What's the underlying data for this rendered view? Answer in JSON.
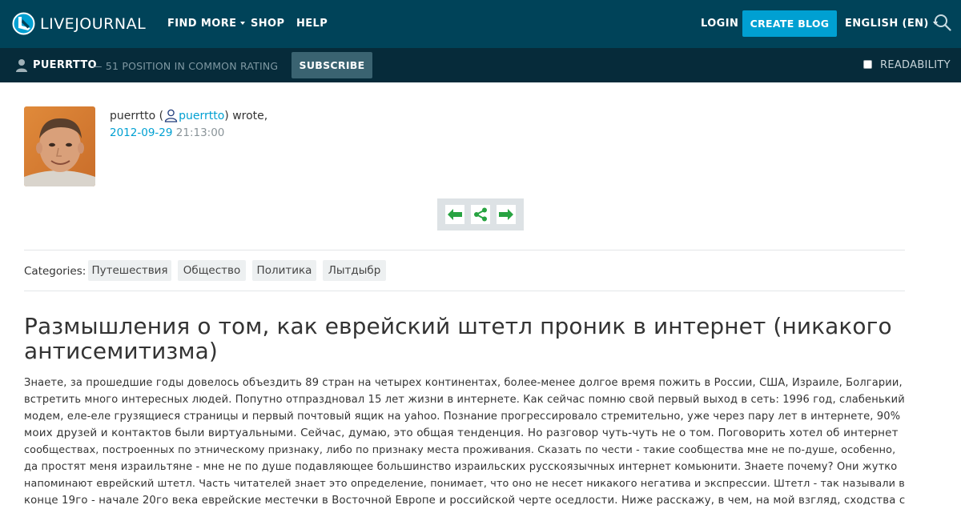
{
  "header": {
    "logo_text": "LIVEJOURNAL",
    "nav": {
      "find_more": "FIND MORE",
      "shop": "SHOP",
      "help": "HELP",
      "login": "LOGIN",
      "create_blog": "CREATE BLOG",
      "language": "ENGLISH (EN)"
    },
    "icons": {
      "search": "search-icon",
      "logo": "livejournal-logo-icon"
    },
    "colors": {
      "bar": "#004359",
      "accent": "#00a0d2"
    }
  },
  "userbar": {
    "username": "PUERRTTO",
    "rating": "— 51 POSITION IN COMMON RATING",
    "subscribe": "SUBSCRIBE",
    "readability": "READABILITY",
    "colors": {
      "bar": "#062b3a",
      "subscribe_bg": "#3a6371"
    }
  },
  "entry": {
    "author_text": "puerrtto (",
    "author_link": "puerrtto",
    "wrote": ") wrote,",
    "date": "2012-09-29",
    "time": "21:13:00",
    "nav_icons": [
      "arrow-left-icon",
      "share-icon",
      "arrow-right-icon"
    ],
    "categories_label": "Categories:",
    "categories": [
      "Путешествия",
      "Общество",
      "Политика",
      "Лытдыбр"
    ],
    "title": "Размышления о том, как еврейский штетл проник в интернет (никакого антисемитизма)",
    "body_lines": [
      "Знаете, за прошедшие годы довелось объездить 89 стран на четырех континентах, более-менее долгое время пожить в России, США, Израиле, Болгарии,",
      "встретить много интересных людей. Попутно отпраздновал 15 лет жизни в интернете. Как сейчас помню свой первый выход в сеть: 1996 год, слабенький",
      "модем, еле-еле грузящиеся страницы и первый почтовый ящик на yahoo. Познание прогрессировало стремительно, уже через пару лет в интернете, 90%",
      "моих друзей и контактов были виртуальными. Сейчас, думаю, это общая тенденция. Но разговор чуть-чуть не о том. Поговорить хотел об интернет",
      "сообществах, построенных по этническому признаку, либо по признаку места проживания. Сказать по чести - такие сообщества мне не по-душе, особенно,",
      "да простят меня израильтяне - мне не по душе подавляющее большинство израильских русскоязычных интернет комьюнити. Знаете почему? Они жутко",
      "напоминают еврейский штетл. Часть читателей знает это определение, понимает, что оно не несет никакого негатива и экспрессии. Штетл - так называли в",
      "конце 19го - начале 20го века еврейские местечки в Восточной Европе и российской черте оседлости. Ниже расскажу, в чем, на мой взгляд, сходства с"
    ]
  }
}
